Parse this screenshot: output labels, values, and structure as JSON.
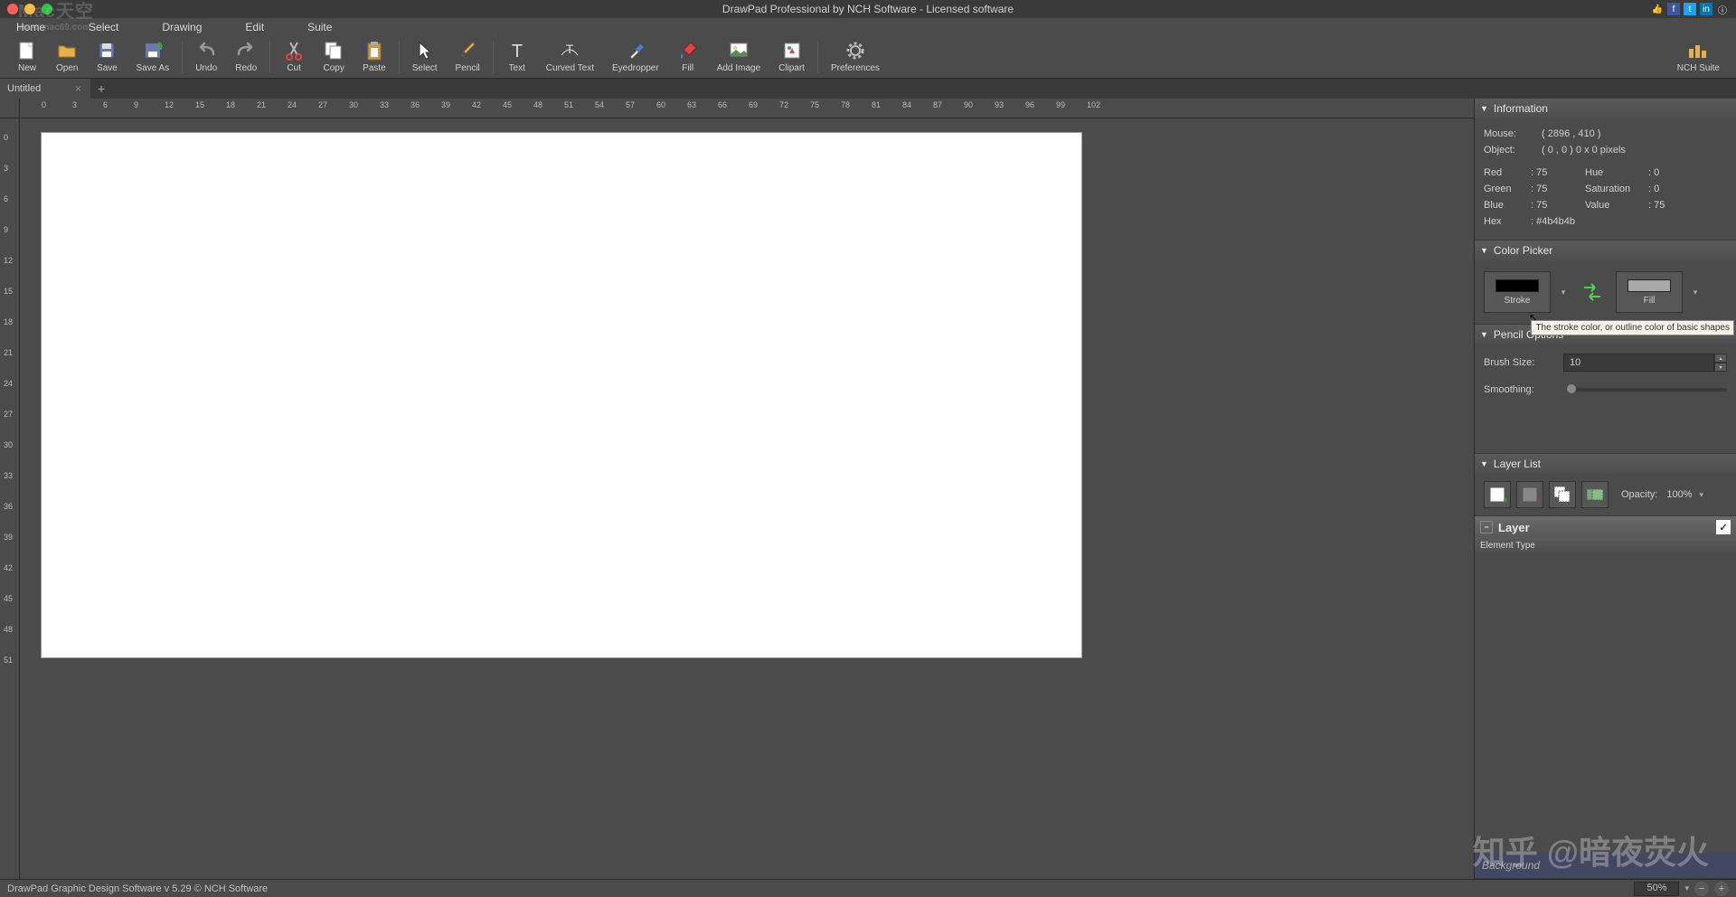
{
  "window": {
    "title": "DrawPad Professional by NCH Software - Licensed software"
  },
  "menubar": [
    "Home",
    "Select",
    "Drawing",
    "Edit",
    "Suite"
  ],
  "toolbar": {
    "groups": [
      [
        "New",
        "Open",
        "Save",
        "Save As"
      ],
      [
        "Undo",
        "Redo"
      ],
      [
        "Cut",
        "Copy",
        "Paste"
      ],
      [
        "Select",
        "Pencil"
      ],
      [
        "Text",
        "Curved Text",
        "Eyedropper",
        "Fill",
        "Add Image",
        "Clipart"
      ],
      [
        "Preferences"
      ]
    ],
    "nch": "NCH Suite"
  },
  "tabs": {
    "active": "Untitled"
  },
  "ruler_h": [
    "0",
    "3",
    "6",
    "9",
    "12",
    "15",
    "18",
    "21",
    "24",
    "27",
    "30",
    "33",
    "36",
    "39",
    "42",
    "45",
    "48",
    "51",
    "54",
    "57",
    "60",
    "63",
    "66",
    "69",
    "72",
    "75",
    "78",
    "81",
    "84",
    "87",
    "90",
    "93",
    "96",
    "99",
    "102"
  ],
  "ruler_v": [
    "0",
    "3",
    "6",
    "9",
    "12",
    "15",
    "18",
    "21",
    "24",
    "27",
    "30",
    "33",
    "36",
    "39",
    "42",
    "45",
    "48",
    "51"
  ],
  "information": {
    "title": "Information",
    "mouse_label": "Mouse:",
    "mouse_value": "( 2896 , 410 )",
    "object_label": "Object:",
    "object_value": "( 0 , 0 ) 0 x 0 pixels",
    "red_label": "Red",
    "red_value": ": 75",
    "green_label": "Green",
    "green_value": ": 75",
    "blue_label": "Blue",
    "blue_value": ": 75",
    "hex_label": "Hex",
    "hex_value": ": #4b4b4b",
    "hue_label": "Hue",
    "hue_value": ": 0",
    "sat_label": "Saturation",
    "sat_value": ": 0",
    "val_label": "Value",
    "val_value": ": 75"
  },
  "color_picker": {
    "title": "Color Picker",
    "stroke_label": "Stroke",
    "fill_label": "Fill",
    "stroke_color": "#000000",
    "fill_color": "#a8a8a8",
    "tooltip": "The stroke color, or outline color of basic shapes"
  },
  "pencil_options": {
    "title": "Pencil Options",
    "brush_label": "Brush Size:",
    "brush_value": "10",
    "smooth_label": "Smoothing:"
  },
  "layer_list": {
    "title": "Layer List",
    "opacity_label": "Opacity:",
    "opacity_value": "100%"
  },
  "layer": {
    "title": "Layer",
    "element_type": "Element Type",
    "background": "Background"
  },
  "statusbar": {
    "left": "DrawPad Graphic Design Software v 5.29 © NCH Software",
    "zoom": "50%"
  },
  "watermarks": {
    "mac": "Mac天空",
    "mac_url": "www.mac69.com",
    "zhihu": "知乎 @暗夜荧火"
  }
}
